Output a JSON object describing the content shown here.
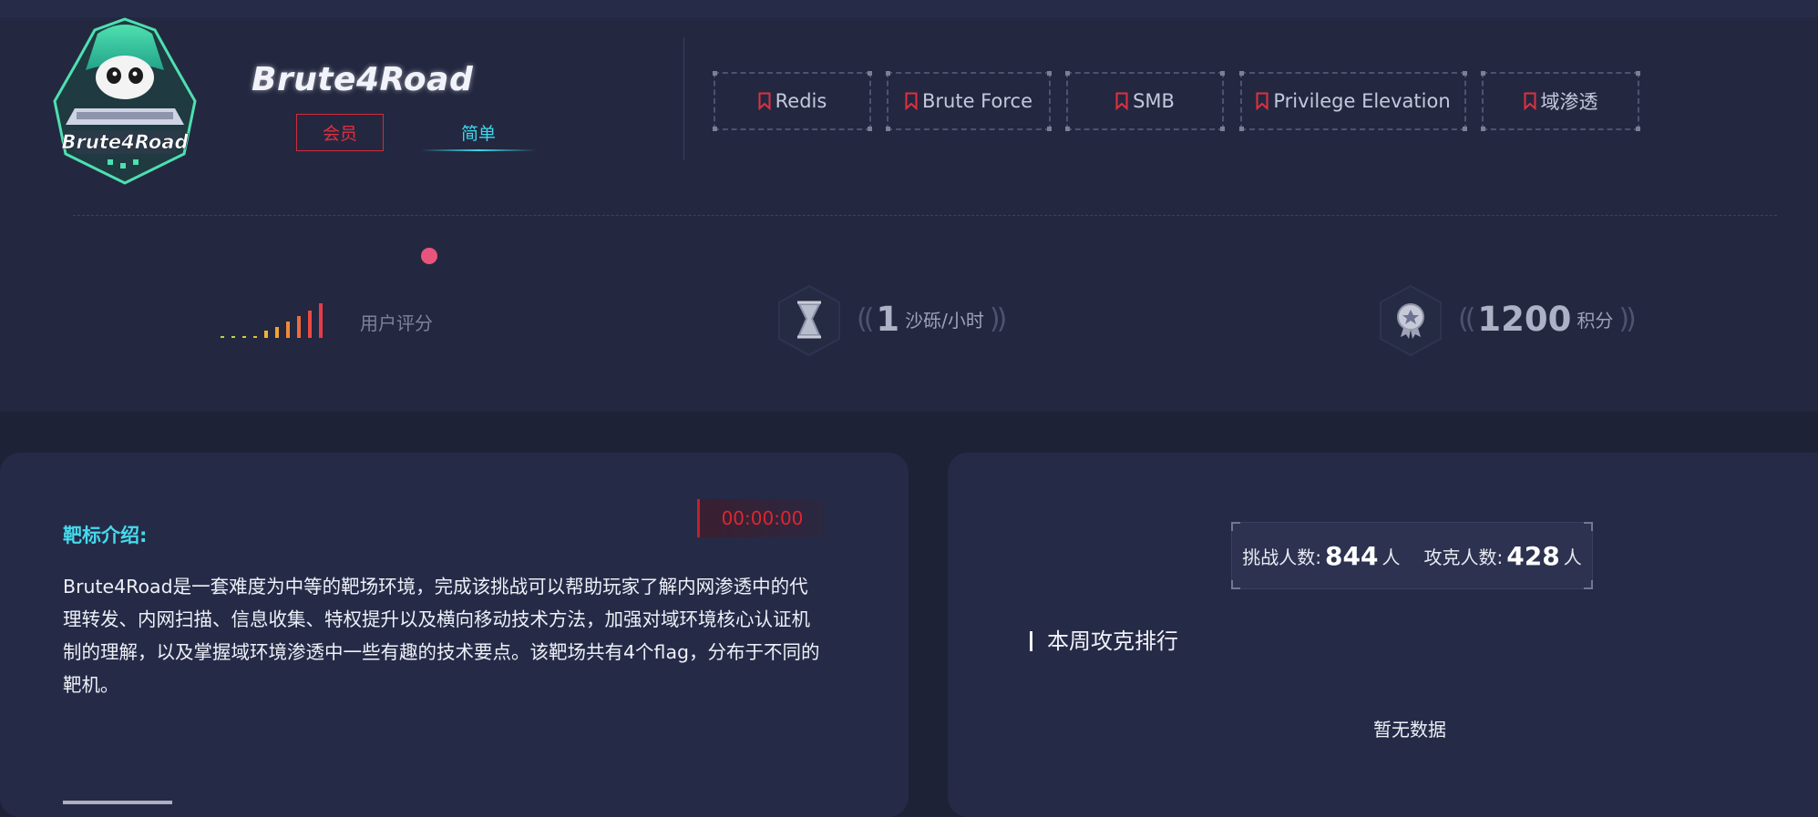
{
  "header": {
    "brand": "Brute4Road",
    "logo_text": "Brute4Road",
    "member_badge": "会员",
    "difficulty_badge": "简单",
    "tags": [
      "Redis",
      "Brute Force",
      "SMB",
      "Privilege Elevation",
      "域渗透"
    ]
  },
  "stats": {
    "rating_label": "用户评分",
    "rating_level": 5,
    "rate_value": "1",
    "rate_unit": "沙砾/小时",
    "points_value": "1200",
    "points_unit": "积分"
  },
  "intro": {
    "title": "靶标介绍:",
    "timer": "00:00:00",
    "text": "Brute4Road是一套难度为中等的靶场环境，完成该挑战可以帮助玩家了解内网渗透中的代理转发、内网扫描、信息收集、特权提升以及横向移动技术方法，加强对域环境核心认证机制的理解，以及掌握域环境渗透中一些有趣的技术要点。该靶场共有4个flag，分布于不同的靶机。"
  },
  "ranking": {
    "challengers_label": "挑战人数:",
    "challengers_count": "844",
    "person_unit": "人",
    "solvers_label": "攻克人数:",
    "solvers_count": "428",
    "weekly_title": "本周攻克排行",
    "empty_text": "暂无数据"
  },
  "colors": {
    "accent_red": "#e0303f",
    "accent_cyan": "#3fd7ea",
    "background": "#1e2236"
  }
}
